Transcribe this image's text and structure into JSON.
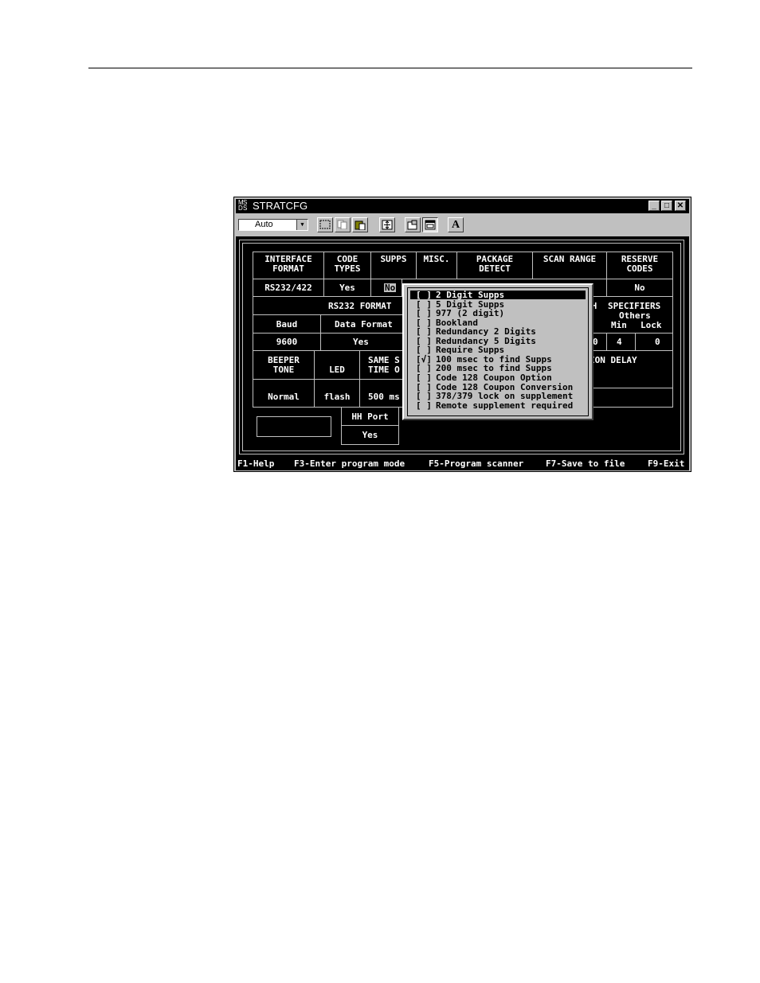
{
  "window": {
    "title": "STRATCFG",
    "minimize": "_",
    "maximize": "□",
    "close": "✕",
    "app_icon_letters": [
      "M",
      "S",
      "D",
      "S"
    ]
  },
  "toolbar": {
    "font_combo_value": "Auto",
    "buttons": [
      {
        "icon": "mark-icon"
      },
      {
        "icon": "copy-icon"
      },
      {
        "icon": "paste-icon"
      },
      {
        "icon": "fullscreen-icon"
      },
      {
        "icon": "properties-icon"
      },
      {
        "icon": "background-icon"
      },
      {
        "icon": "font-icon",
        "label": "A"
      }
    ]
  },
  "table": {
    "headers": {
      "interface_format": [
        "INTERFACE",
        "FORMAT"
      ],
      "code_types": [
        "CODE",
        "TYPES"
      ],
      "supps": "SUPPS",
      "misc": "MISC.",
      "package_detect": [
        "PACKAGE",
        "DETECT"
      ],
      "scan_range": "SCAN RANGE",
      "reserve_codes": [
        "RESERVE",
        "CODES"
      ]
    },
    "values": {
      "interface_format": "RS232/422",
      "code_types": "Yes",
      "supps": "No",
      "reserve_codes": "No"
    },
    "rs232": {
      "title": "RS232 FORMAT",
      "baud_label": "Baud",
      "data_format_label": "Data Format",
      "baud": "9600",
      "data_format": "Yes"
    },
    "length": {
      "fragment": "TH",
      "title": "SPECIFIERS",
      "others": "Others",
      "min_label": "Min",
      "lock_label": "Lock",
      "fragment_value": "0",
      "min": "4",
      "lock": "0"
    },
    "beeper": {
      "tone_label": [
        "BEEPER",
        "TONE"
      ],
      "led_label": "LED",
      "same_label": [
        "SAME S",
        "TIME O"
      ],
      "tone": "Normal",
      "led": "flash",
      "same": "500 ms"
    },
    "delay_fragment": "ION DELAY",
    "hh_port_label": "HH Port",
    "hh_port": "Yes"
  },
  "popup": {
    "options": [
      {
        "check": "[ ]",
        "label": "2 Digit Supps",
        "selected": true
      },
      {
        "check": "[ ]",
        "label": "5 Digit Supps",
        "selected": false
      },
      {
        "check": "[ ]",
        "label": "977 (2 digit)",
        "selected": false
      },
      {
        "check": "[ ]",
        "label": "Bookland",
        "selected": false
      },
      {
        "check": "[ ]",
        "label": "Redundancy 2 Digits",
        "selected": false
      },
      {
        "check": "[ ]",
        "label": "Redundancy 5 Digits",
        "selected": false
      },
      {
        "check": "[ ]",
        "label": "Require Supps",
        "selected": false
      },
      {
        "check": "[√]",
        "label": "100 msec to find Supps",
        "selected": false
      },
      {
        "check": "[ ]",
        "label": "200 msec to find Supps",
        "selected": false
      },
      {
        "check": "[ ]",
        "label": "Code 128 Coupon Option",
        "selected": false
      },
      {
        "check": "[ ]",
        "label": "Code 128 Coupon Conversion",
        "selected": false
      },
      {
        "check": "[ ]",
        "label": "378/379 lock on supplement",
        "selected": false
      },
      {
        "check": "[ ]",
        "label": "Remote supplement required",
        "selected": false
      }
    ]
  },
  "statusbar": {
    "f1": "F1-Help",
    "f3": "F3-Enter program mode",
    "f5": "F5-Program scanner",
    "f7": "F7-Save to file",
    "f9": "F9-Exit"
  }
}
